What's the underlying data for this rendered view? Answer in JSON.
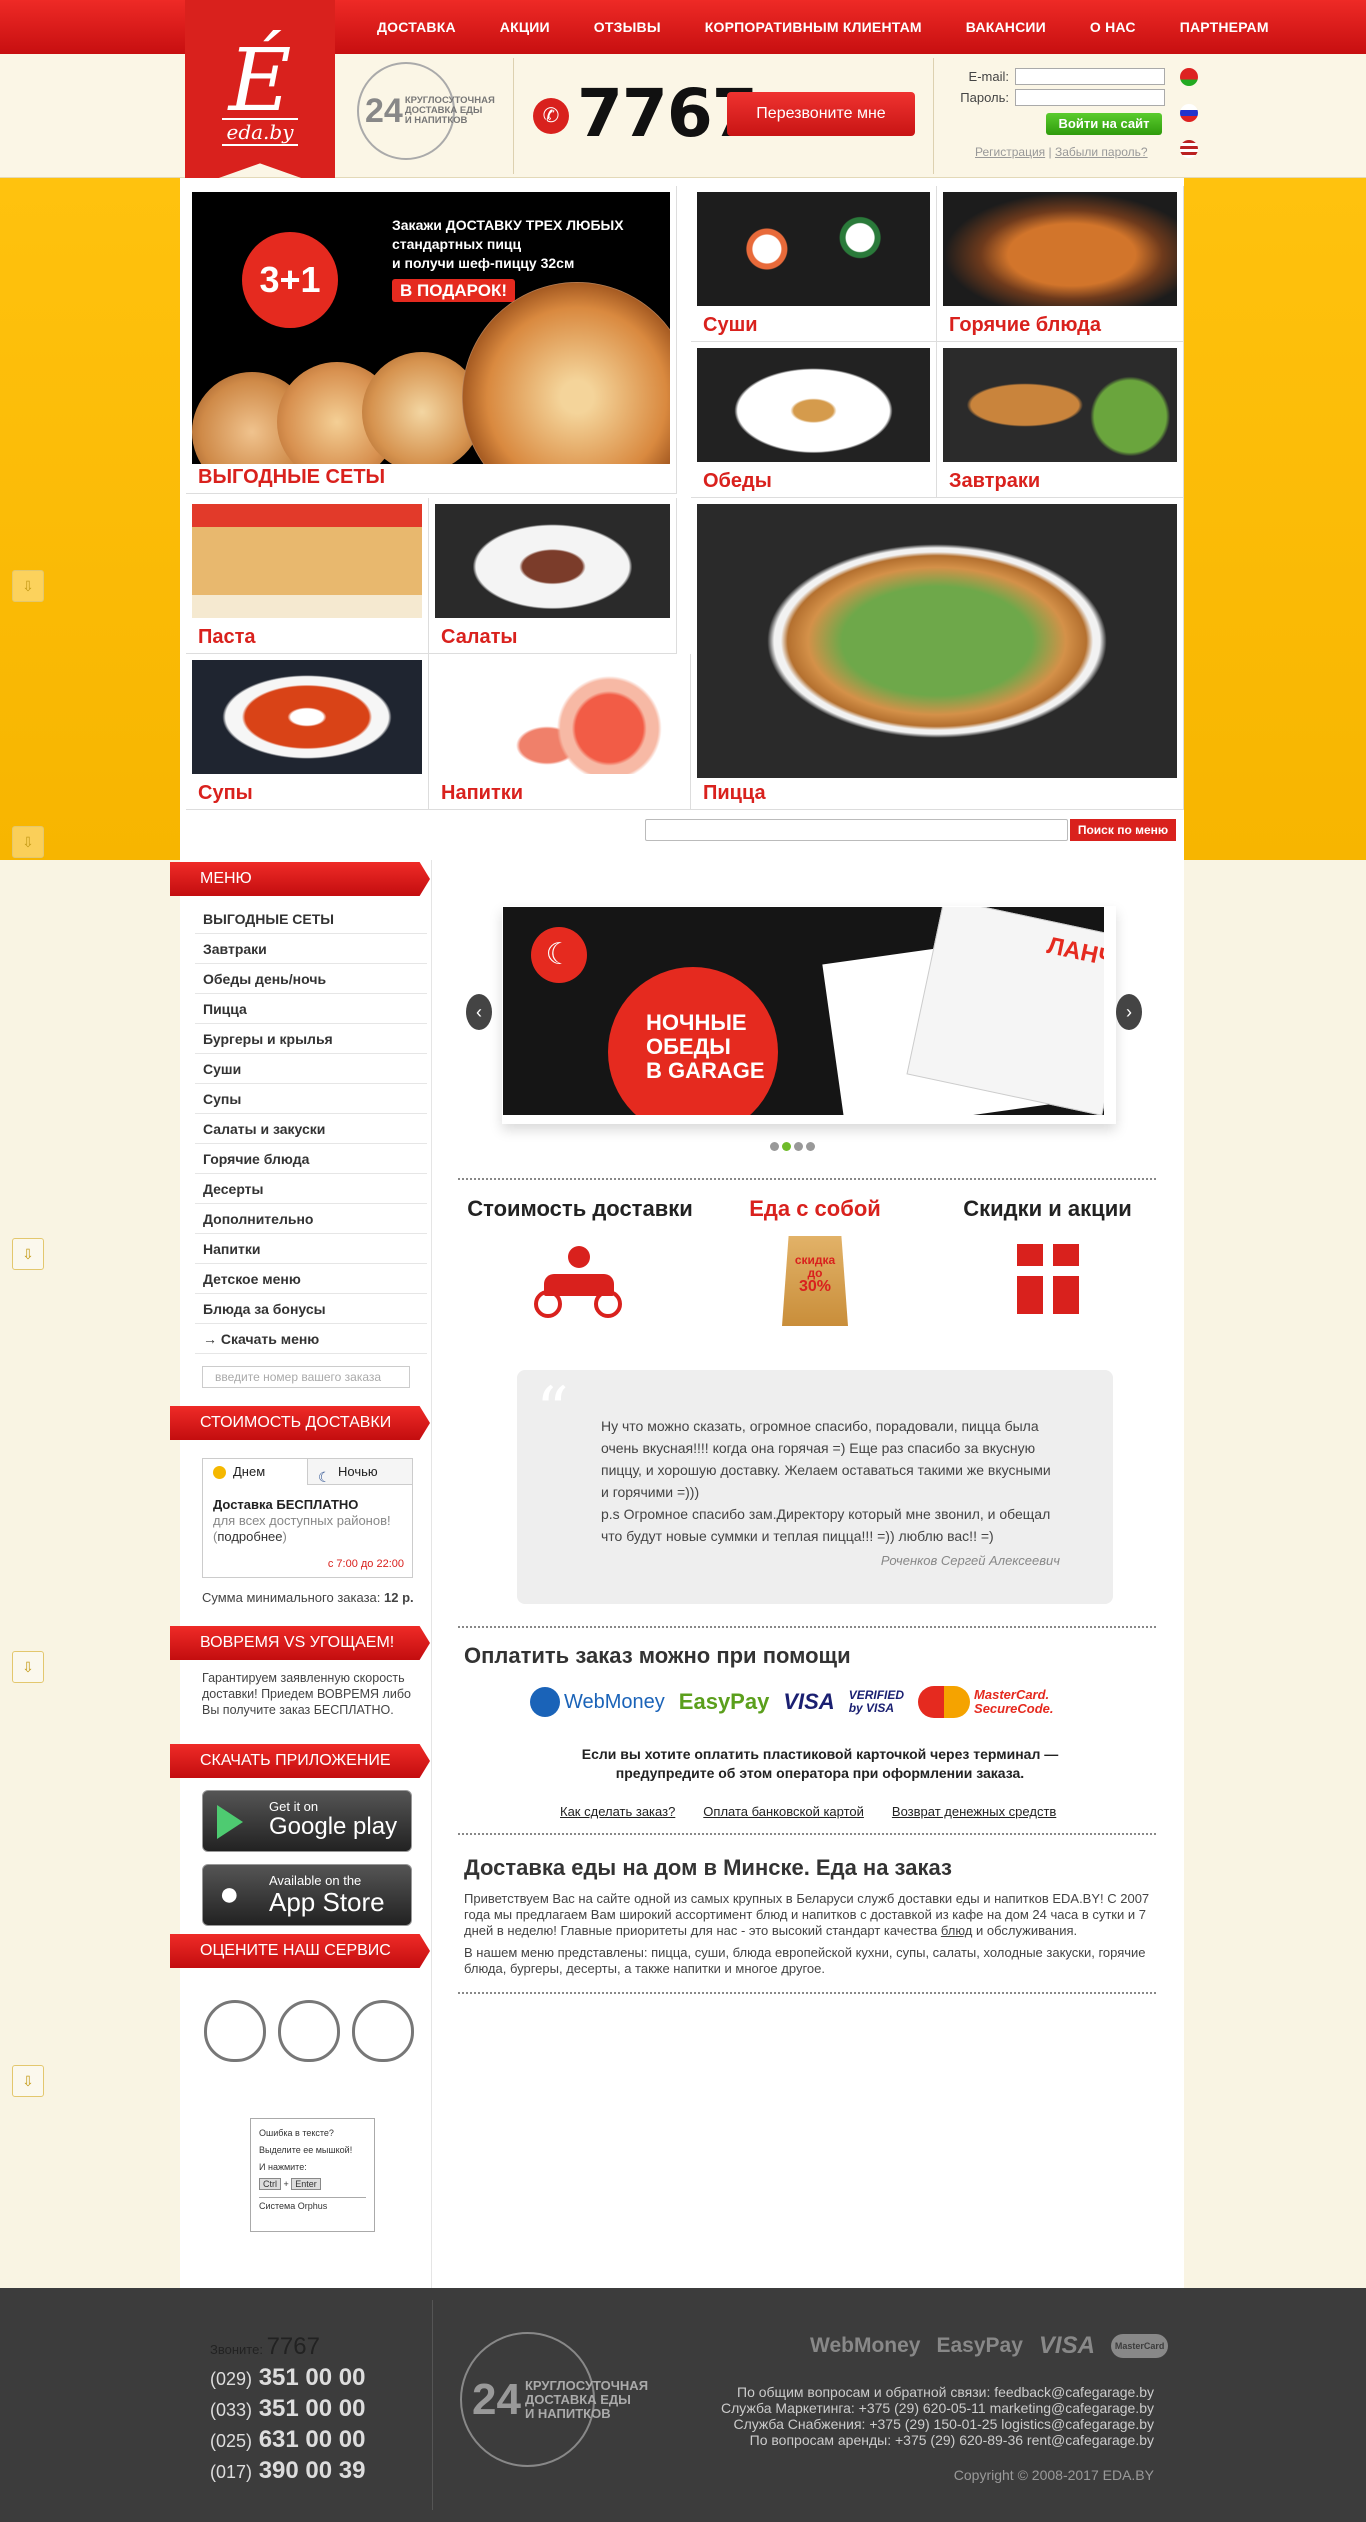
{
  "nav": [
    "ДОСТАВКА",
    "АКЦИИ",
    "ОТЗЫВЫ",
    "КОРПОРАТИВНЫМ КЛИЕНТАМ",
    "ВАКАНСИИ",
    "О НАС",
    "ПАРТНЕРАМ"
  ],
  "logo": {
    "letter": "É",
    "domain": "eda.by"
  },
  "badge": {
    "num": "24",
    "text": "КРУГЛОСУТОЧНАЯ ДОСТАВКА ЕДЫ И НАПИТКОВ"
  },
  "phone": "7767",
  "callback": "Перезвоните мне",
  "login": {
    "email_label": "E-mail:",
    "password_label": "Пароль:",
    "submit": "Войти на сайт",
    "register": "Регистрация",
    "forgot": "Забыли пароль?"
  },
  "promo": {
    "badge": "3+1",
    "line1": "Закажи ДОСТАВКУ ТРЕХ ЛЮБЫХ",
    "line2": "стандартных пицц",
    "line3": "и получи  шеф-пиццу 32см",
    "gift": "В ПОДАРОК!"
  },
  "tiles": {
    "sets": "ВЫГОДНЫЕ СЕТЫ",
    "sushi": "Суши",
    "hot": "Горячие блюда",
    "lunch": "Обеды",
    "breakfast": "Завтраки",
    "pasta": "Паста",
    "salads": "Салаты",
    "pizza": "Пицца",
    "soups": "Супы",
    "drinks": "Напитки"
  },
  "search_btn": "Поиск по меню",
  "sidebar": {
    "menu_title": "МЕНЮ",
    "menu": [
      "ВЫГОДНЫЕ СЕТЫ",
      "Завтраки",
      "Обеды день/ночь",
      "Пицца",
      "Бургеры и крылья",
      "Суши",
      "Супы",
      "Салаты и закуски",
      "Горячие блюда",
      "Десерты",
      "Дополнительно",
      "Напитки",
      "Детское меню",
      "Блюда за бонусы",
      "→ Скачать меню"
    ],
    "order_placeholder": "введите номер вашего заказа",
    "delivery_title": "СТОИМОСТЬ ДОСТАВКИ",
    "day": "Днем",
    "night": "Ночью",
    "free": "Доставка БЕСПЛАТНО",
    "areas": "для всех доступных районов! (",
    "more": "подробнее",
    "areas_end": ")",
    "hours": "с 7:00 до 22:00",
    "min_order_label": "Сумма минимального заказа:",
    "min_order": "12 р.",
    "ontime_title": "ВОВРЕМЯ VS УГОЩАЕМ!",
    "ontime_text": "Гарантируем заявленную скорость доставки! Приедем ВОВРЕМЯ либо Вы получите заказ БЕСПЛАТНО.",
    "app_title": "СКАЧАТЬ ПРИЛОЖЕНИЕ",
    "gp_small": "Get it on",
    "gp_big": "Google play",
    "as_small": "Available on the",
    "as_big": "App Store",
    "rate_title": "ОЦЕНИТЕ НАШ СЕРВИС",
    "orphus": [
      "Ошибка в тексте?",
      "Выделите ее мышкой!",
      "И нажмите:",
      "Ctrl",
      "+",
      "Enter",
      "Система Orphus"
    ]
  },
  "slide": {
    "text1": "НОЧНЫЕ",
    "text2": "ОБЕДЫ",
    "text3": "В GARAGE",
    "tag": "ЛАНЧ"
  },
  "features": {
    "delivery": "Стоимость доставки",
    "takeaway": "Еда с собой",
    "discounts": "Скидки и акции",
    "bag1": "скидка",
    "bag2": "до",
    "bag3": "30%"
  },
  "review": {
    "text": "Ну что можно сказать, огромное спасибо, порадовали, пицца была очень вкусная!!!! когда она горячая =) Еще раз спасибо за вкусную пиццу, и хорошую доставку. Желаем оставаться такими же вкусными и горячими =)))",
    "ps": "p.s Огромное спасибо зам.Директору который мне звонил, и обещал что будут новые суммки и теплая пицца!!! =)) люблю вас!! =)",
    "author": "Роченков Сергей Алексеевич"
  },
  "pay": {
    "title": "Оплатить заказ можно при помощи",
    "logos": {
      "webmoney": "WebMoney",
      "easypay": "EasyPay",
      "visa": "VISA",
      "vbv1": "VERIFIED",
      "vbv2": "by VISA",
      "mc1": "MasterCard.",
      "mc2": "SecureCode."
    },
    "note": "Если вы хотите оплатить пластиковой карточкой через терминал — предупредите об этом оператора при оформлении заказа.",
    "links": [
      "Как сделать заказ?",
      "Оплата банковской картой",
      "Возврат денежных средств"
    ]
  },
  "about": {
    "title": "Доставка еды на дом в Минске. Еда на заказ",
    "p1_a": "Приветствуем Вас на сайте одной из самых крупных в Беларуси служб доставки еды и напитков EDA.BY! С 2007 года мы предлагаем Вам широкий ассортимент блюд и напитков с доставкой из кафе на дом 24 часа в сутки и 7 дней в неделю! Главные приоритеты для нас - это высокий стандарт качества ",
    "p1_link": "блюд",
    "p1_b": " и обслуживания.",
    "p2": "В нашем меню представлены: пицца, суши, блюда европейской кухни, супы, салаты, холодные закуски, горячие блюда, бургеры, десерты, а также напитки и многое другое."
  },
  "footer": {
    "call": "Звоните:",
    "short": "7767",
    "phones": [
      {
        "code": "(029)",
        "num": "351 00 00"
      },
      {
        "code": "(033)",
        "num": "351 00 00"
      },
      {
        "code": "(025)",
        "num": "631 00 00"
      },
      {
        "code": "(017)",
        "num": "390 00 39"
      }
    ],
    "badge_num": "24",
    "badge_text": "КРУГЛОСУТОЧНАЯ ДОСТАВКА ЕДЫ И НАПИТКОВ",
    "pay_logos": [
      "WebMoney",
      "EasyPay",
      "VISA",
      "MasterCard"
    ],
    "contacts": [
      "По общим вопросам и обратной связи: feedback@cafegarage.by",
      "Служба Маркетинга: +375 (29) 620-05-11 marketing@cafegarage.by",
      "Служба Снабжения: +375 (29) 150-01-25 logistics@cafegarage.by",
      "По вопросам аренды: +375 (29) 620-89-36 rent@cafegarage.by"
    ],
    "copyright": "Copyright © 2008-2017 EDA.BY"
  }
}
